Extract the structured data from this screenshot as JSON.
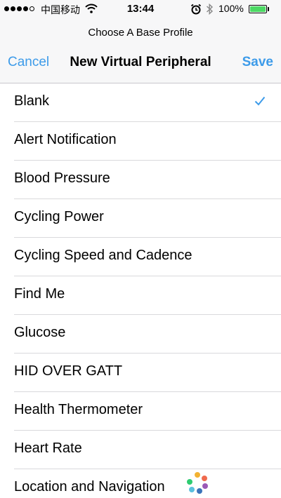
{
  "status_bar": {
    "signal_dots_filled": 4,
    "signal_dots_total": 5,
    "carrier": "中国移动",
    "wifi_icon": "wifi-icon",
    "time": "13:44",
    "alarm_icon": "alarm-icon",
    "bluetooth_icon": "bluetooth-icon",
    "battery_percent": "100%",
    "battery_level": 1.0,
    "battery_color": "#4cd964"
  },
  "header": {
    "prompt": "Choose A Base Profile",
    "cancel_label": "Cancel",
    "title": "New Virtual Peripheral",
    "save_label": "Save",
    "accent_color": "#3d9be9"
  },
  "profiles": {
    "selected_index": 0,
    "items": [
      {
        "label": "Blank"
      },
      {
        "label": "Alert Notification"
      },
      {
        "label": "Blood Pressure"
      },
      {
        "label": "Cycling Power"
      },
      {
        "label": "Cycling Speed and Cadence"
      },
      {
        "label": "Find Me"
      },
      {
        "label": "Glucose"
      },
      {
        "label": "HID OVER GATT"
      },
      {
        "label": "Health Thermometer"
      },
      {
        "label": "Heart Rate"
      },
      {
        "label": "Location and Navigation"
      }
    ]
  }
}
